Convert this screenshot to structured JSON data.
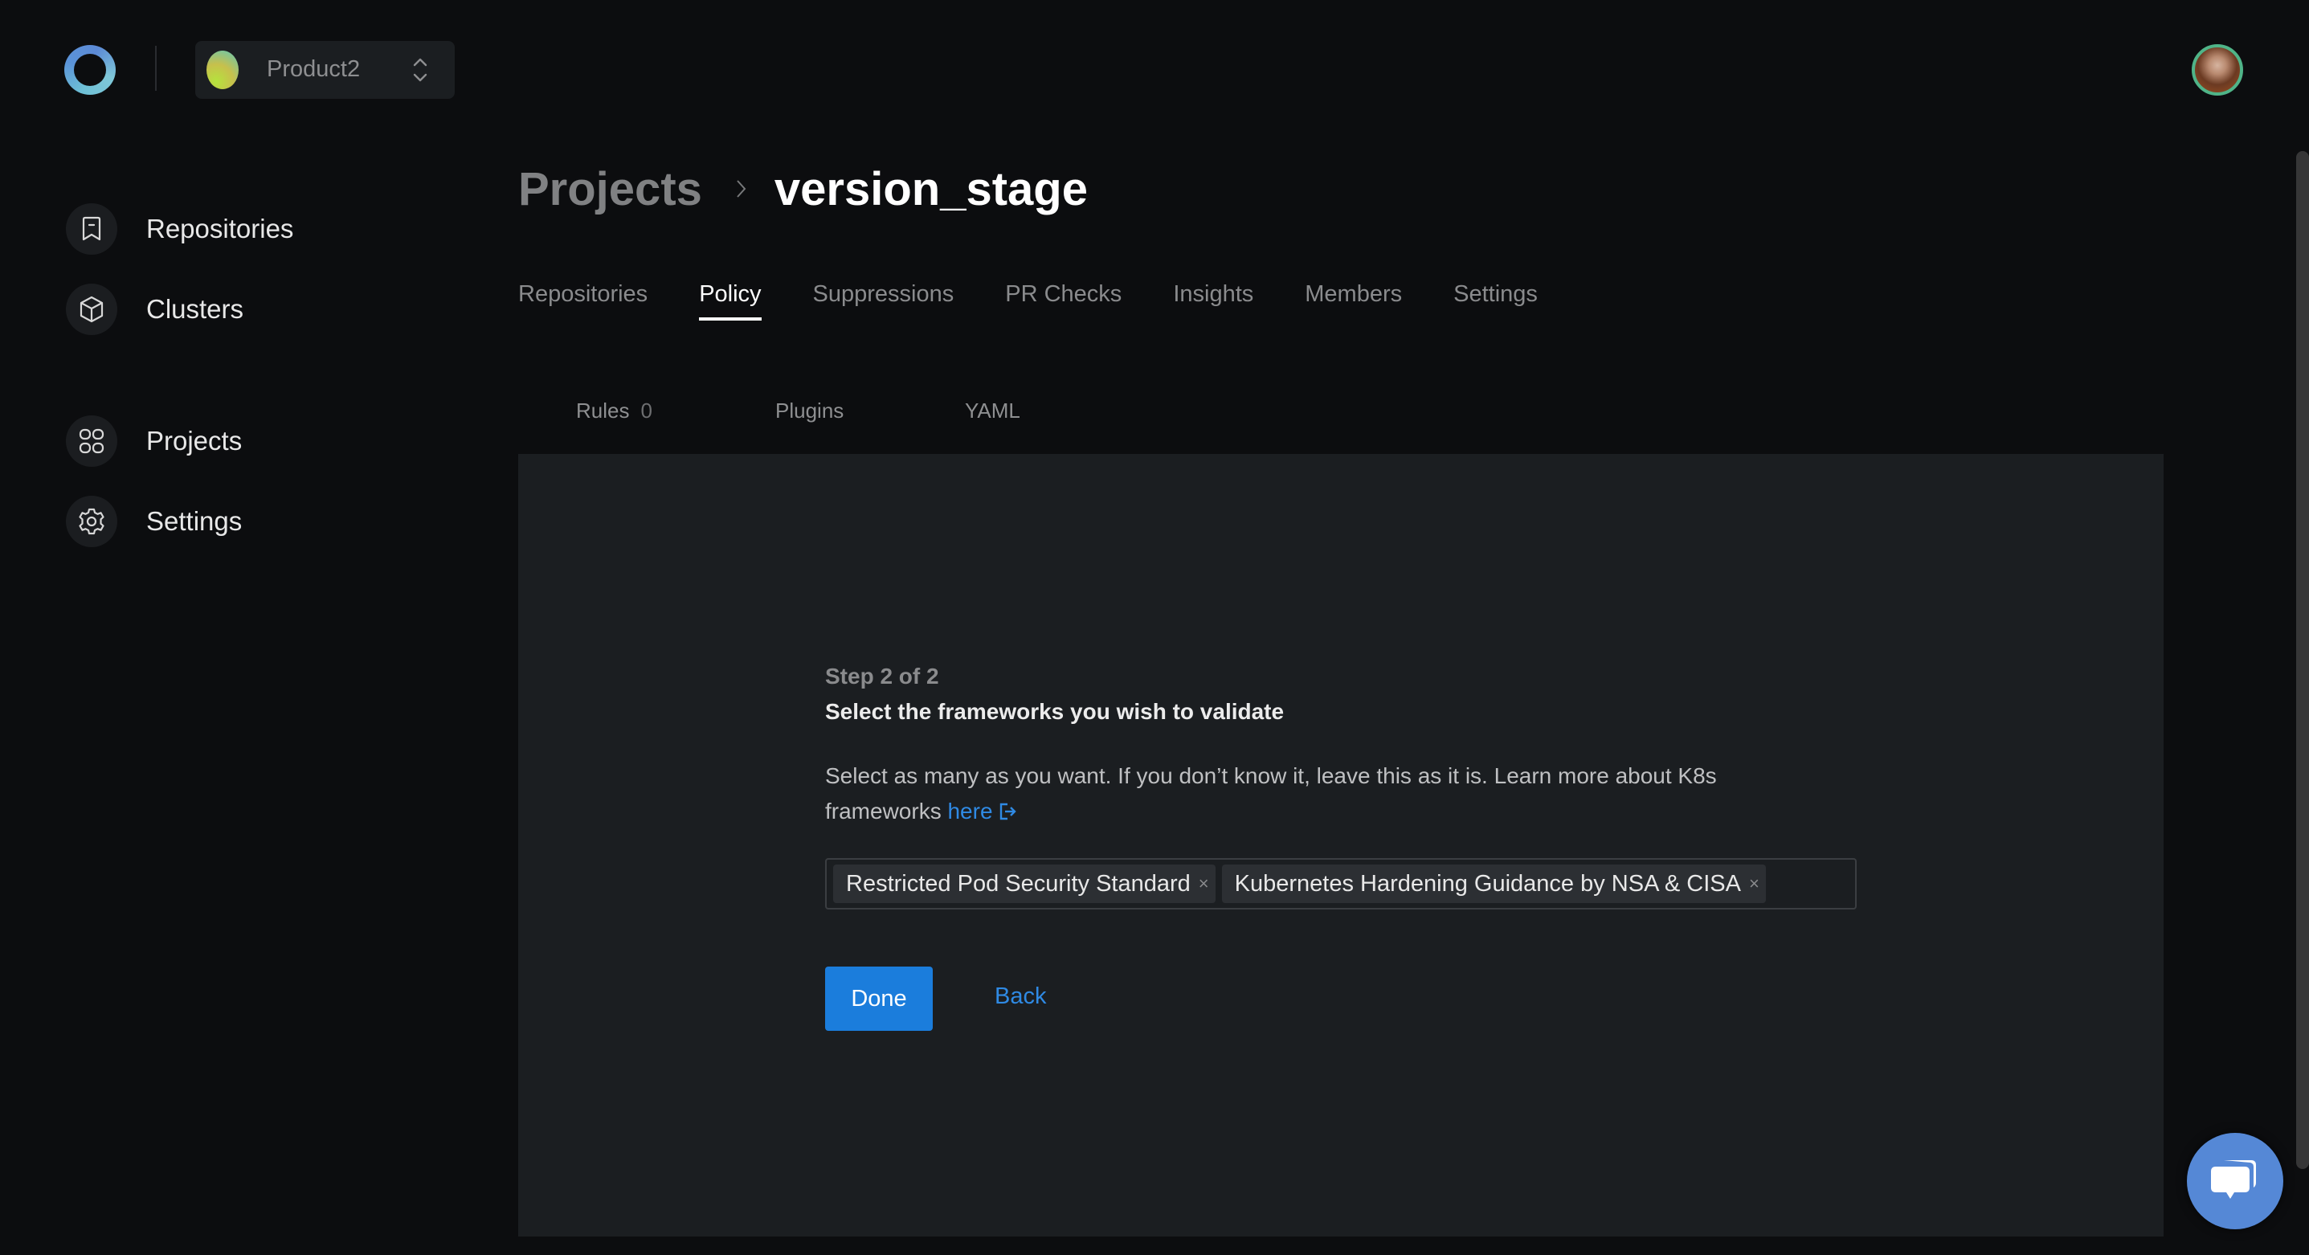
{
  "org_selector": {
    "name": "Product2"
  },
  "sidebar": {
    "items": [
      {
        "label": "Repositories",
        "icon": "bookmark-icon"
      },
      {
        "label": "Clusters",
        "icon": "cube-icon"
      },
      {
        "label": "Projects",
        "icon": "grid-icon"
      },
      {
        "label": "Settings",
        "icon": "gear-icon"
      }
    ]
  },
  "breadcrumb": {
    "parent": "Projects",
    "current": "version_stage"
  },
  "tabs": [
    {
      "label": "Repositories",
      "active": false
    },
    {
      "label": "Policy",
      "active": true
    },
    {
      "label": "Suppressions",
      "active": false
    },
    {
      "label": "PR Checks",
      "active": false
    },
    {
      "label": "Insights",
      "active": false
    },
    {
      "label": "Members",
      "active": false
    },
    {
      "label": "Settings",
      "active": false
    }
  ],
  "subtabs": [
    {
      "label": "Rules",
      "count": "0"
    },
    {
      "label": "Plugins"
    },
    {
      "label": "YAML"
    }
  ],
  "wizard": {
    "step": "Step 2 of 2",
    "heading": "Select the frameworks you wish to validate",
    "description": "Select as many as you want. If you don’t know it, leave this as it is. Learn more about K8s frameworks",
    "link_label": "here",
    "selected_frameworks": [
      "Restricted Pod Security Standard",
      "Kubernetes Hardening Guidance by NSA & CISA"
    ],
    "remove_glyph": "×",
    "done_label": "Done",
    "back_label": "Back"
  },
  "colors": {
    "accent": "#1b7ddc",
    "link": "#2f8ae4",
    "chat": "#5588d6",
    "avatar_ring": "#4fb488"
  }
}
